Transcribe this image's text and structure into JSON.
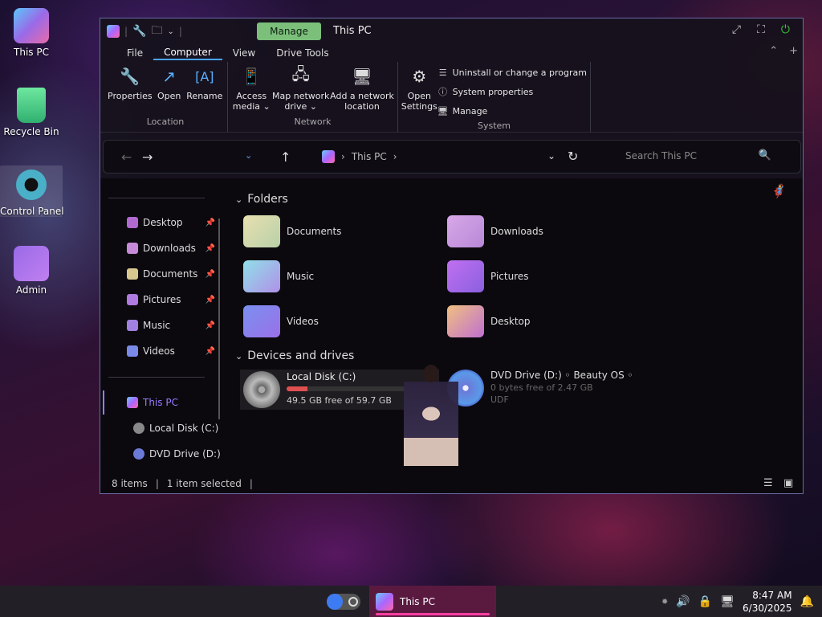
{
  "desktop": {
    "icons": [
      {
        "label": "This PC"
      },
      {
        "label": "Recycle Bin"
      },
      {
        "label": "Control Panel"
      },
      {
        "label": "Admin"
      }
    ]
  },
  "window": {
    "title": "This PC",
    "context_tab": "Manage",
    "tabs": [
      "File",
      "Computer",
      "View",
      "Drive Tools"
    ],
    "active_tab": "Computer"
  },
  "ribbon": {
    "location": {
      "label": "Location",
      "buttons": [
        {
          "label": "Properties",
          "icon": "wrench-icon"
        },
        {
          "label": "Open",
          "icon": "open-icon"
        },
        {
          "label": "Rename",
          "icon": "rename-icon"
        }
      ]
    },
    "network": {
      "label": "Network",
      "buttons": [
        {
          "label": "Access\nmedia ⌄",
          "icon": "media-icon"
        },
        {
          "label": "Map network\ndrive ⌄",
          "icon": "map-drive-icon"
        },
        {
          "label": "Add a network\nlocation",
          "icon": "add-location-icon"
        }
      ]
    },
    "system": {
      "label": "System",
      "open_settings": "Open\nSettings",
      "rows": [
        {
          "label": "Uninstall or change a program",
          "icon": "list-icon"
        },
        {
          "label": "System properties",
          "icon": "info-icon"
        },
        {
          "label": "Manage",
          "icon": "manage-icon"
        }
      ]
    }
  },
  "address": {
    "crumb": "This PC",
    "search_placeholder": "Search This PC"
  },
  "nav": {
    "quick": [
      {
        "label": "Desktop",
        "color": "#b06ad0"
      },
      {
        "label": "Downloads",
        "color": "#c78ad8"
      },
      {
        "label": "Documents",
        "color": "#d8c890"
      },
      {
        "label": "Pictures",
        "color": "#b07ae0"
      },
      {
        "label": "Music",
        "color": "#a080e0"
      },
      {
        "label": "Videos",
        "color": "#7a8ae8"
      }
    ],
    "this_pc": "This PC",
    "drives": [
      "Local Disk (C:)",
      "DVD Drive (D:)"
    ]
  },
  "content": {
    "folders_header": "Folders",
    "folders": [
      {
        "label": "Documents",
        "color": "#d6cc9a"
      },
      {
        "label": "Downloads",
        "color": "#c290d8"
      },
      {
        "label": "Music",
        "color": "#8ac8d8"
      },
      {
        "label": "Pictures",
        "color": "#b070e0"
      },
      {
        "label": "Videos",
        "color": "#8090e8"
      },
      {
        "label": "Desktop",
        "color": "#e0a070"
      }
    ],
    "drives_header": "Devices and drives",
    "drives": [
      {
        "name": "Local Disk (C:)",
        "free": "49.5 GB free of 59.7 GB",
        "used_fraction": 0.17
      },
      {
        "name": "DVD Drive (D:) ◦ Beauty OS ◦",
        "free": "0 bytes free of 2.47 GB",
        "fs": "UDF"
      }
    ]
  },
  "status": {
    "items": "8 items",
    "selected": "1 item selected"
  },
  "taskbar": {
    "app_label": "This PC",
    "time": "8:47 AM",
    "date": "6/30/2025"
  }
}
